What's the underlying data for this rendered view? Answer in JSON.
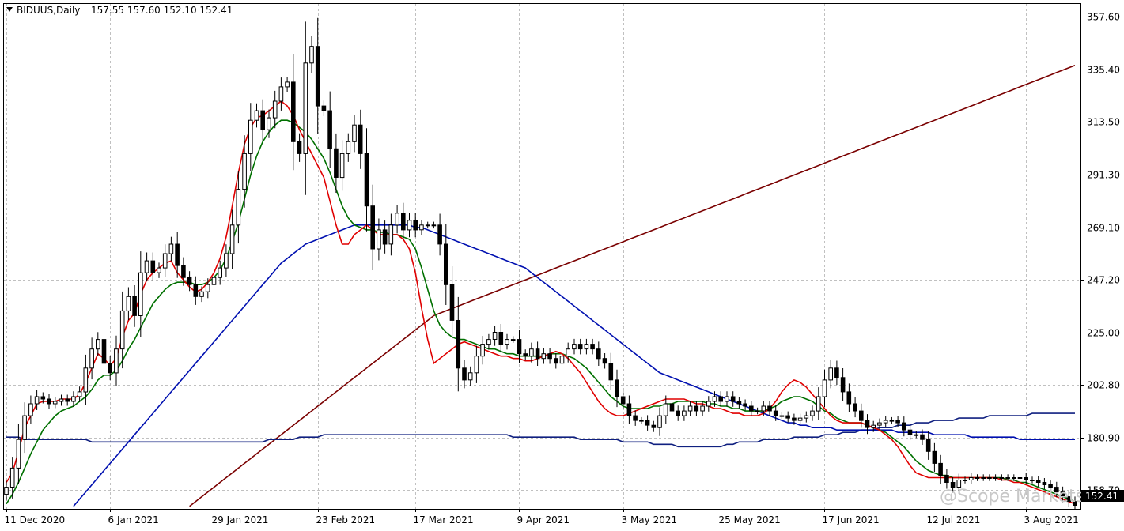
{
  "header": {
    "symbol": "BIDUUS,Daily",
    "ohlc": "157.55 157.60 152.10 152.41"
  },
  "watermark": "@Scope Markets",
  "price_badge": "152.41",
  "colors": {
    "bull_body": "#ffffff",
    "bear_body": "#000000",
    "ma_fast": "#e00000",
    "ma_medium": "#007000",
    "ma_slow": "#0010b0",
    "ma_long": "#7a0000",
    "ma_ref": "#102080"
  },
  "chart_data": {
    "type": "candlestick",
    "y_ticks": [
      158.7,
      180.9,
      202.8,
      225.0,
      247.2,
      269.1,
      291.3,
      313.5,
      335.4,
      357.6
    ],
    "y_tick_labels": [
      "158.70",
      "180.90",
      "202.80",
      "225.00",
      "247.20",
      "269.10",
      "291.30",
      "313.50",
      "335.40",
      "357.60"
    ],
    "ylim": [
      150.9,
      362.8
    ],
    "x_labels": [
      {
        "label": "11 Dec 2020",
        "index": 0
      },
      {
        "label": "6 Jan 2021",
        "index": 17
      },
      {
        "label": "29 Jan 2021",
        "index": 34
      },
      {
        "label": "23 Feb 2021",
        "index": 51
      },
      {
        "label": "17 Mar 2021",
        "index": 67
      },
      {
        "label": "9 Apr 2021",
        "index": 84
      },
      {
        "label": "3 May 2021",
        "index": 101
      },
      {
        "label": "25 May 2021",
        "index": 117
      },
      {
        "label": "17 Jun 2021",
        "index": 134
      },
      {
        "label": "12 Jul 2021",
        "index": 151
      },
      {
        "label": "3 Aug 2021",
        "index": 167
      }
    ],
    "bars": 176,
    "close": [
      160,
      168,
      180,
      190,
      195,
      198,
      197,
      195,
      196,
      197,
      196,
      198,
      200,
      210,
      218,
      222,
      212,
      208,
      218,
      234,
      240,
      232,
      250,
      255,
      250,
      252,
      258,
      262,
      253,
      248,
      245,
      240,
      242,
      245,
      248,
      252,
      258,
      270,
      285,
      300,
      314,
      318,
      310,
      315,
      322,
      328,
      330,
      305,
      300,
      338,
      345,
      320,
      318,
      302,
      290,
      300,
      305,
      312,
      300,
      278,
      260,
      268,
      262,
      270,
      275,
      268,
      272,
      268,
      270,
      270,
      270,
      262,
      245,
      230,
      210,
      205,
      208,
      215,
      220,
      222,
      225,
      220,
      222,
      222,
      216,
      215,
      218,
      214,
      216,
      214,
      212,
      215,
      218,
      220,
      218,
      220,
      218,
      214,
      212,
      205,
      198,
      195,
      190,
      188,
      188,
      186,
      185,
      190,
      195,
      192,
      190,
      192,
      194,
      192,
      194,
      196,
      198,
      196,
      198,
      196,
      195,
      194,
      192,
      192,
      194,
      192,
      190,
      190,
      189,
      188,
      189,
      190,
      192,
      198,
      205,
      210,
      206,
      200,
      195,
      192,
      188,
      185,
      186,
      187,
      188,
      188,
      187,
      184,
      182,
      182,
      180,
      175,
      170,
      165,
      162,
      160,
      163,
      163,
      164,
      164,
      164,
      164,
      164,
      164,
      164,
      164,
      164,
      163,
      163,
      162,
      161,
      160,
      158,
      156,
      154,
      152.41
    ],
    "ma_fast": [
      162,
      166,
      175,
      185,
      190,
      195,
      196,
      196,
      196,
      197,
      197,
      197,
      199,
      204,
      210,
      216,
      214,
      211,
      214,
      223,
      230,
      233,
      241,
      247,
      250,
      252,
      254,
      255,
      250,
      247,
      244,
      242,
      243,
      246,
      250,
      256,
      265,
      278,
      292,
      304,
      311,
      315,
      316,
      318,
      320,
      322,
      320,
      316,
      310,
      305,
      300,
      295,
      290,
      280,
      270,
      262,
      262,
      266,
      268,
      270,
      268,
      266,
      266,
      266,
      266,
      264,
      260,
      250,
      235,
      222,
      212,
      214,
      216,
      218,
      220,
      221,
      220,
      219,
      218,
      217,
      216,
      215,
      215,
      214,
      214,
      213,
      213,
      214,
      215,
      216,
      217,
      216,
      214,
      211,
      208,
      204,
      200,
      196,
      193,
      191,
      190,
      190,
      191,
      192,
      193,
      194,
      195,
      196,
      197,
      197,
      197,
      197,
      196,
      195,
      195,
      194,
      193,
      193,
      192,
      191,
      191,
      190,
      190,
      190,
      191,
      193,
      196,
      200,
      203,
      205,
      204,
      202,
      199,
      196,
      193,
      190,
      188,
      187,
      187,
      187,
      187,
      186,
      185,
      184,
      182,
      180,
      177,
      173,
      169,
      166,
      165,
      164,
      164,
      164,
      164,
      164,
      164,
      164,
      164,
      164,
      164,
      164,
      164,
      163,
      163,
      162,
      162,
      161,
      160,
      159,
      158,
      157,
      156,
      155,
      154,
      153
    ],
    "ma_medium": [
      153,
      157,
      162,
      168,
      174,
      179,
      184,
      187,
      190,
      192,
      193,
      194,
      196,
      198,
      201,
      205,
      207,
      207,
      209,
      213,
      218,
      222,
      227,
      232,
      237,
      240,
      243,
      245,
      246,
      246,
      246,
      245,
      245,
      246,
      248,
      251,
      256,
      263,
      271,
      281,
      291,
      299,
      305,
      309,
      312,
      314,
      314,
      313,
      311,
      309,
      306,
      302,
      298,
      292,
      285,
      278,
      273,
      270,
      269,
      268,
      268,
      267,
      267,
      266,
      266,
      265,
      264,
      260,
      252,
      243,
      234,
      228,
      225,
      223,
      222,
      222,
      221,
      220,
      219,
      218,
      218,
      217,
      216,
      216,
      215,
      215,
      215,
      215,
      215,
      216,
      216,
      216,
      215,
      214,
      212,
      210,
      207,
      204,
      201,
      198,
      196,
      194,
      193,
      193,
      193,
      193,
      194,
      194,
      195,
      195,
      196,
      196,
      196,
      196,
      196,
      195,
      195,
      194,
      194,
      193,
      193,
      192,
      192,
      192,
      192,
      193,
      194,
      196,
      197,
      198,
      198,
      197,
      196,
      194,
      192,
      191,
      189,
      188,
      187,
      187,
      187,
      186,
      185,
      184,
      183,
      181,
      179,
      177,
      174,
      171,
      169,
      167,
      166,
      165,
      165,
      164,
      164,
      164,
      164,
      164,
      164,
      164,
      164,
      164,
      163,
      163,
      162,
      162,
      161,
      160,
      159,
      158,
      157,
      156,
      155,
      154
    ],
    "ma_slow": [
      131,
      132,
      134,
      136,
      138,
      140,
      142,
      144,
      146,
      148,
      150,
      152,
      155,
      158,
      161,
      164,
      167,
      170,
      173,
      176,
      179,
      182,
      185,
      188,
      191,
      194,
      197,
      200,
      203,
      206,
      209,
      212,
      215,
      218,
      221,
      224,
      227,
      230,
      233,
      236,
      239,
      242,
      245,
      248,
      251,
      254,
      256,
      258,
      260,
      262,
      263,
      264,
      265,
      266,
      267,
      268,
      269,
      270,
      270,
      270,
      270,
      270,
      270,
      270,
      270,
      270,
      270,
      269,
      269,
      268,
      267,
      266,
      265,
      264,
      263,
      262,
      261,
      260,
      259,
      258,
      257,
      256,
      255,
      254,
      253,
      252,
      250,
      248,
      246,
      244,
      242,
      240,
      238,
      236,
      234,
      232,
      230,
      228,
      226,
      224,
      222,
      220,
      218,
      216,
      214,
      212,
      210,
      208,
      207,
      206,
      205,
      204,
      203,
      202,
      201,
      200,
      199,
      198,
      197,
      196,
      195,
      194,
      193,
      192,
      191,
      190,
      189,
      188,
      187,
      187,
      186,
      186,
      185,
      185,
      185,
      185,
      184,
      184,
      184,
      184,
      184,
      184,
      184,
      184,
      184,
      184,
      183,
      183,
      183,
      183,
      183,
      183,
      182,
      182,
      182,
      182,
      182,
      182,
      181,
      181,
      181,
      181,
      181,
      181,
      181,
      181,
      180,
      180,
      180,
      180,
      180,
      180,
      180,
      180,
      180,
      180
    ],
    "ma_long": [
      118,
      119,
      120,
      121,
      122,
      123,
      124,
      125,
      126,
      127,
      128,
      129,
      130,
      131,
      132,
      133,
      134,
      135,
      136,
      137,
      138,
      139,
      140,
      141,
      142,
      143,
      144,
      146,
      148,
      150,
      152,
      154,
      156,
      158,
      160,
      162,
      164,
      166,
      168,
      170,
      172,
      174,
      176,
      178,
      180,
      182,
      184,
      186,
      188,
      190,
      192,
      194,
      196,
      198,
      200,
      202,
      204,
      206,
      208,
      210,
      212,
      214,
      216,
      218,
      220,
      222,
      224,
      226,
      228,
      230,
      232,
      233,
      234,
      235,
      236,
      237,
      238,
      239,
      240,
      241,
      242,
      243,
      244,
      245,
      246,
      247,
      248,
      249,
      250,
      251,
      252,
      253,
      254,
      255,
      256,
      257,
      258,
      259,
      260,
      261,
      262,
      263,
      264,
      265,
      266,
      267,
      268,
      269,
      270,
      271,
      272,
      273,
      274,
      275,
      276,
      277,
      278,
      279,
      280,
      281,
      282,
      283,
      284,
      285,
      286,
      287,
      288,
      289,
      290,
      291,
      292,
      293,
      294,
      295,
      296,
      297,
      298,
      299,
      300,
      301,
      302,
      303,
      304,
      305,
      306,
      307,
      308,
      309,
      310,
      311,
      312,
      313,
      314,
      315,
      316,
      317,
      318,
      319,
      320,
      321,
      322,
      323,
      324,
      325,
      326,
      327,
      328,
      329,
      330,
      331,
      332,
      333,
      334,
      335,
      336,
      337
    ],
    "ma_ref": [
      181,
      181,
      181,
      180,
      180,
      180,
      180,
      180,
      180,
      180,
      180,
      180,
      180,
      180,
      179,
      179,
      179,
      179,
      179,
      179,
      179,
      179,
      179,
      179,
      179,
      179,
      179,
      179,
      179,
      179,
      179,
      179,
      179,
      179,
      179,
      179,
      179,
      179,
      179,
      179,
      179,
      179,
      179,
      180,
      180,
      180,
      180,
      180,
      181,
      181,
      181,
      181,
      182,
      182,
      182,
      182,
      182,
      182,
      182,
      182,
      182,
      182,
      182,
      182,
      182,
      182,
      182,
      182,
      182,
      182,
      182,
      182,
      182,
      182,
      182,
      182,
      182,
      182,
      182,
      182,
      182,
      182,
      182,
      181,
      181,
      181,
      181,
      181,
      181,
      181,
      181,
      181,
      181,
      181,
      180,
      180,
      180,
      180,
      180,
      180,
      180,
      179,
      179,
      179,
      179,
      179,
      178,
      178,
      178,
      178,
      177,
      177,
      177,
      177,
      177,
      177,
      177,
      177,
      178,
      178,
      179,
      179,
      179,
      179,
      180,
      180,
      180,
      180,
      180,
      181,
      181,
      181,
      181,
      181,
      182,
      182,
      182,
      183,
      183,
      183,
      184,
      184,
      184,
      185,
      185,
      185,
      186,
      186,
      186,
      187,
      187,
      187,
      188,
      188,
      188,
      188,
      189,
      189,
      189,
      189,
      189,
      190,
      190,
      190,
      190,
      190,
      190,
      190,
      191,
      191,
      191,
      191,
      191,
      191,
      191,
      191
    ]
  }
}
